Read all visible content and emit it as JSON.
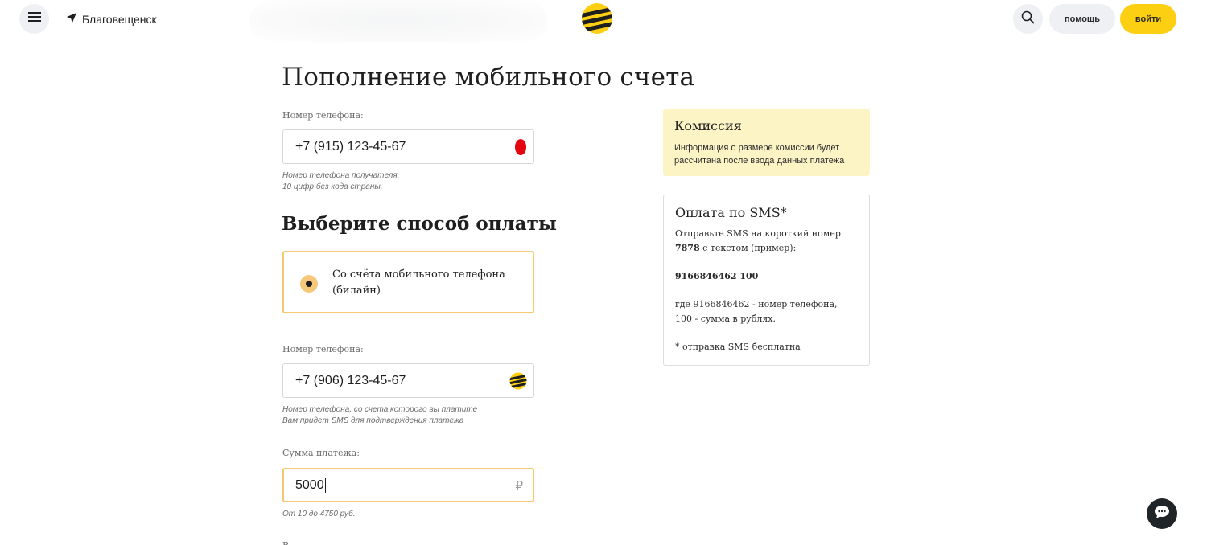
{
  "header": {
    "city": "Благовещенск",
    "help_label": "помощь",
    "login_label": "войти"
  },
  "page": {
    "title": "Пополнение мобильного счета"
  },
  "recipient": {
    "label": "Номер телефона:",
    "value": "+7 (915) 123-45-67",
    "hint_line1": "Номер телефона получателя.",
    "hint_line2": "10 цифр без кода страны."
  },
  "payment_method": {
    "title": "Выберите способ оплаты",
    "option_label": "Со счёта мобильного телефона (билайн)",
    "selected": true
  },
  "payer": {
    "label": "Номер телефона:",
    "value": "+7 (906) 123-45-67",
    "hint_line1": "Номер телефона, со счета которого вы платите",
    "hint_line2": "Вам придет SMS для подтверждения платежа"
  },
  "amount": {
    "label": "Сумма платежа:",
    "value": "5000",
    "currency": "₽",
    "hint": "От 10 до 4750 руб."
  },
  "commission": {
    "title": "Комиссия",
    "text": "Информация о размере комиссии будет рассчитана после ввода данных платежа"
  },
  "sms": {
    "title": "Оплата по SMS*",
    "intro_before": "Отправьте SMS на короткий номер ",
    "short_number": "7878",
    "intro_after": " с текстом (пример):",
    "example": "9166846462 100",
    "explain_line1": "где 9166846462 - номер телефона,",
    "explain_line2": "100 - сумма в рублях.",
    "footnote": "* отправка SMS бесплатна"
  },
  "colors": {
    "brand_yellow": "#fccf13",
    "accent_border": "#f4c870",
    "commission_bg": "#fdf4c6",
    "mts_red": "#e30611"
  }
}
